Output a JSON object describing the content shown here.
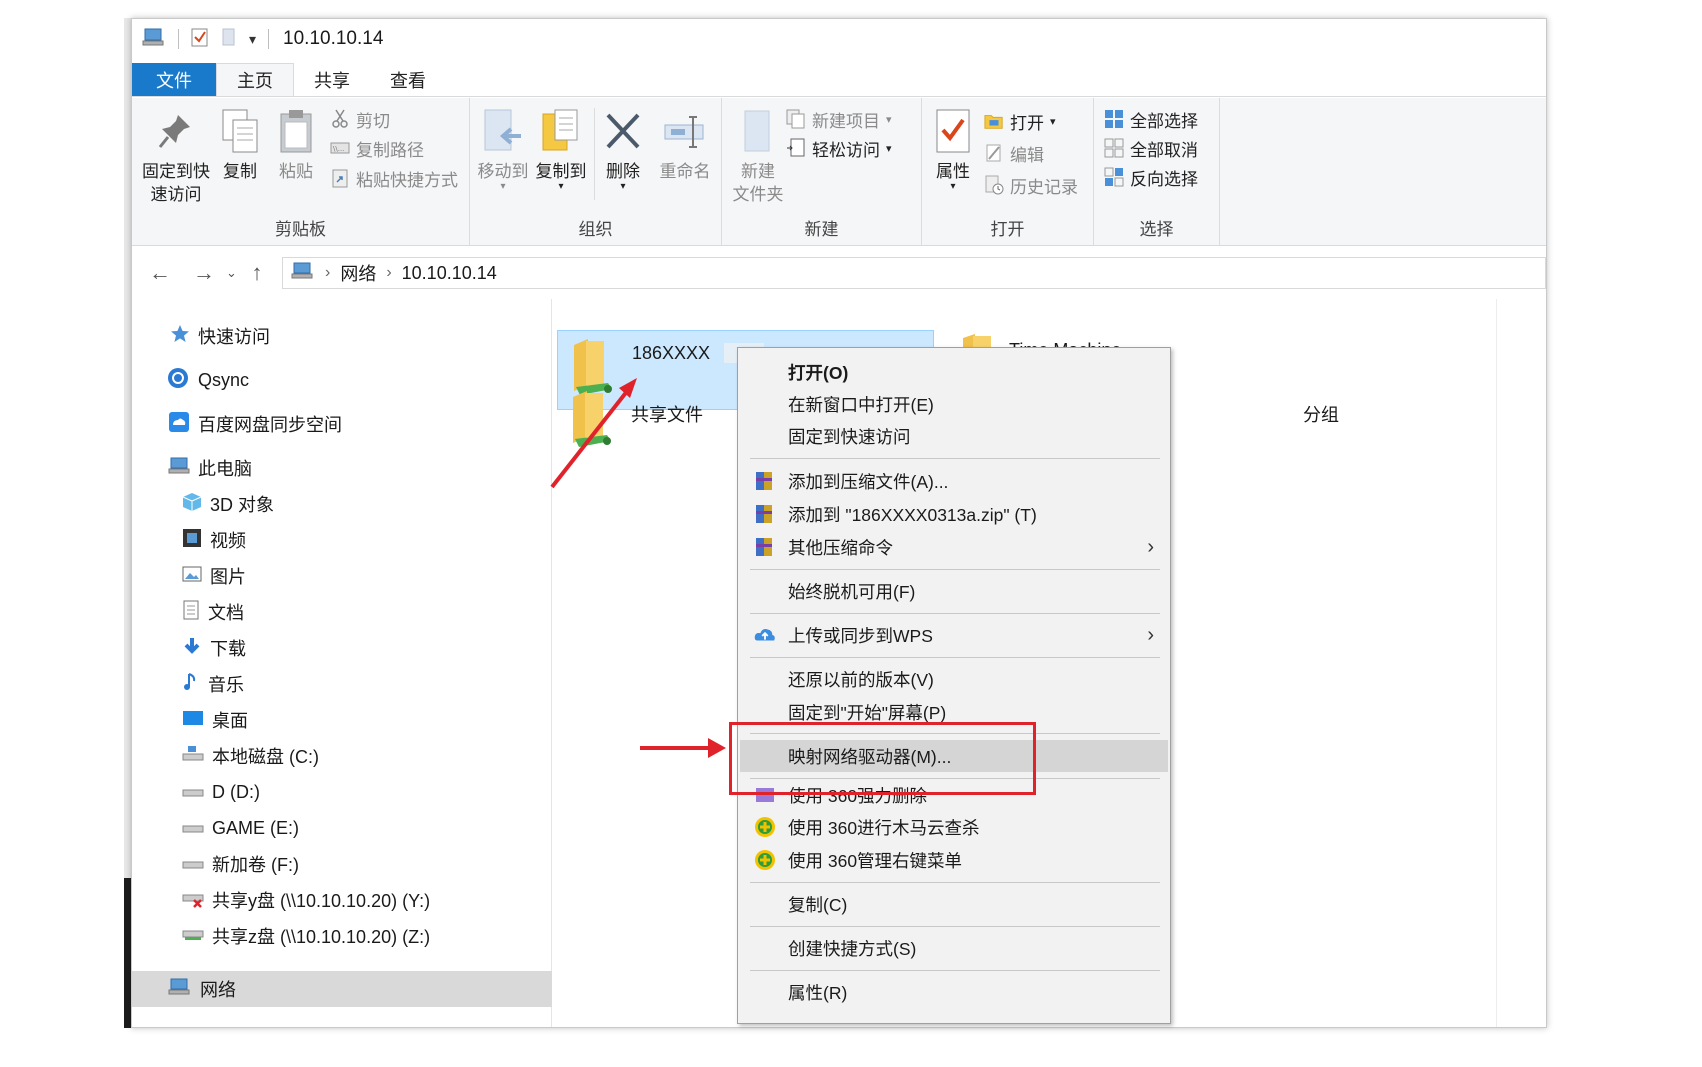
{
  "window": {
    "title": "10.10.10.14"
  },
  "tabs": {
    "file": "文件",
    "home": "主页",
    "share": "共享",
    "view": "查看"
  },
  "ribbon": {
    "clipboard": {
      "label": "剪贴板",
      "pin_line1": "固定到快",
      "pin_line2": "速访问",
      "copy": "复制",
      "paste": "粘贴",
      "cut": "剪切",
      "copy_path": "复制路径",
      "paste_shortcut": "粘贴快捷方式"
    },
    "organize": {
      "label": "组织",
      "move_to": "移动到",
      "copy_to": "复制到",
      "delete": "删除",
      "rename": "重命名"
    },
    "new": {
      "label": "新建",
      "new_folder_line1": "新建",
      "new_folder_line2": "文件夹",
      "new_item": "新建项目",
      "easy_access": "轻松访问"
    },
    "open": {
      "label": "打开",
      "properties": "属性",
      "open": "打开",
      "edit": "编辑",
      "history": "历史记录"
    },
    "select": {
      "label": "选择",
      "select_all": "全部选择",
      "select_none": "全部取消",
      "invert": "反向选择"
    }
  },
  "address": {
    "root": "网络",
    "current": "10.10.10.14"
  },
  "navpane": {
    "items": [
      {
        "label": "快速访问",
        "icon": "star-icon"
      },
      {
        "label": "Qsync",
        "icon": "sync-icon"
      },
      {
        "label": "百度网盘同步空间",
        "icon": "cloud-icon"
      },
      {
        "label": "此电脑",
        "icon": "computer-icon"
      },
      {
        "label": "3D 对象",
        "icon": "cube-icon"
      },
      {
        "label": "视频",
        "icon": "video-icon"
      },
      {
        "label": "图片",
        "icon": "pictures-icon"
      },
      {
        "label": "文档",
        "icon": "document-icon"
      },
      {
        "label": "下载",
        "icon": "download-icon"
      },
      {
        "label": "音乐",
        "icon": "music-icon"
      },
      {
        "label": "桌面",
        "icon": "desktop-icon"
      },
      {
        "label": "本地磁盘 (C:)",
        "icon": "drive-icon"
      },
      {
        "label": "D (D:)",
        "icon": "drive-icon"
      },
      {
        "label": "GAME (E:)",
        "icon": "drive-icon"
      },
      {
        "label": "新加卷 (F:)",
        "icon": "drive-icon"
      },
      {
        "label": "共享y盘 (\\\\10.10.10.20) (Y:)",
        "icon": "network-drive-disconnected-icon"
      },
      {
        "label": "共享z盘 (\\\\10.10.10.20) (Z:)",
        "icon": "network-drive-icon"
      },
      {
        "label": "网络",
        "icon": "network-icon"
      }
    ]
  },
  "content": {
    "items": [
      {
        "name": "186XXXX"
      },
      {
        "name": "Time Machine"
      },
      {
        "name": "共享文件"
      },
      {
        "name": "分组"
      }
    ]
  },
  "context_menu": {
    "open": "打开(O)",
    "open_new_window": "在新窗口中打开(E)",
    "pin_quick_access": "固定到快速访问",
    "add_to_archive": "添加到压缩文件(A)...",
    "add_to_zip": "添加到 \"186XXXX0313a.zip\" (T)",
    "other_compress": "其他压缩命令",
    "always_offline": "始终脱机可用(F)",
    "upload_wps": "上传或同步到WPS",
    "restore_versions": "还原以前的版本(V)",
    "pin_start": "固定到\"开始\"屏幕(P)",
    "map_drive": "映射网络驱动器(M)...",
    "force_delete_360": "使用 360强力删除",
    "scan_360": "使用 360进行木马云查杀",
    "manage_360": "使用 360管理右键菜单",
    "copy": "复制(C)",
    "create_shortcut": "创建快捷方式(S)",
    "properties": "属性(R)"
  },
  "colors": {
    "accent": "#1979ca",
    "selection": "#cce8ff",
    "highlight_box": "#e0232b",
    "annotation_arrow": "#e0232b"
  }
}
